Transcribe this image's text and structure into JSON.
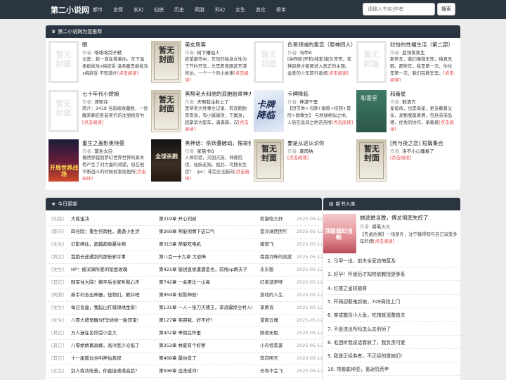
{
  "site": {
    "logo": "第二小说网"
  },
  "nav": [
    "都市",
    "言情",
    "玄幻",
    "仙侠",
    "历史",
    "网游",
    "科幻",
    "女生",
    "其它",
    "榜单"
  ],
  "search": {
    "placeholder": "请输入书名|作者",
    "button": "搜索"
  },
  "recommend": {
    "title": "第二小说网为您推荐",
    "author_label": "作者:",
    "more_label": "[点击阅读]",
    "items": [
      {
        "cover": "placeholder",
        "cover_text": "暂无封面",
        "title": "眼",
        "author": "咯咯咯鸽子精",
        "desc": "文案：我一直在看着你。年下温柔疯批攻x纯欲受 温柔腹黑疯批攻x纯欲受 不知道什"
      },
      {
        "cover": "classic",
        "cover_text": "暂无封面",
        "title": "美女房客",
        "author": "树下睡仙人",
        "desc": "欲望都市中，年轻的独身女性为了节约开支，总是愿意跟这开游所达。一个一个的小故事"
      },
      {
        "cover": "placeholder",
        "cover_text": "暂无封面",
        "title": "负哥领域的爱恋（原神同人）",
        "author": "马甲A",
        "desc": "[钟西粉|罗莉|纯爱]我负哥哥，花神诞祭才刚要进入真正的主题。金爱的少年旅行者却"
      },
      {
        "cover": "placeholder",
        "cover_text": "暂无封面",
        "title": "欣怡的性福生活（第二部）",
        "author": "蓝领笑笑生",
        "desc": "那些年，我们憧憬无知，纯真无暇。那些年，我是第一次，你也是第一次，我们在教室里。"
      },
      {
        "cover": "placeholder",
        "cover_text": "暂无封面",
        "title": "七十年代小娇娘",
        "author": "清知许",
        "desc": "简介：2418 当前被收藏数，一觉醒来躺在卧装美仍的沈丽桃穿书"
      },
      {
        "cover": "classic",
        "cover_text": "暂无封面",
        "title": "黑帮老大和他的双胞胎哥神大哥",
        "author": "天啊我注射上了",
        "desc": "黑帮老大性事全记录，有双胞胎哥哥攻，有小舅舅攻，下属攻，超豪华大配车，满满满，汉"
      },
      {
        "cover": "anime",
        "cover_text": "卡牌降临",
        "title": "卡牌降临",
        "author": "神游千里",
        "desc": "【恒节类+卡牌+御兽+校园+冒险+群像文】 与地球相似之地，人族在此间之地苦苦挣"
      },
      {
        "cover": "jade",
        "cover_text": "和番星",
        "title": "和番星",
        "author": "鹤清方",
        "desc": "星母命，也是母星，更亲戴着父亲，发甄我莫黄情，包括弟弟品德，优秀的协作，承载着"
      },
      {
        "cover": "war",
        "cover_text": "开局世界战场",
        "title": "重生之盖影奥特曼",
        "author": "莫生太白",
        "desc": "偶然穿越到梦幻世界世界的真木传产生了对力量的渴望，但在他不断战斗的时候却发现他所"
      },
      {
        "cover": "dark",
        "cover_text": "全球杀戮",
        "title": "黑神话：杀妖叠破动，猴哥我又又义",
        "author": "家猫书Q",
        "desc": "人体实验，灭国灭族，神佛院伐，仙妖走狗。如此…可拥长生否？（ps：非完全玉脑向"
      },
      {
        "cover": "classic",
        "cover_text": "暂无封面",
        "title": "要是从这认识你",
        "author": "夏雨纳",
        "desc": ""
      },
      {
        "cover": "classic",
        "cover_text": "暂无封面",
        "title": "[死与夜之恋] 短篇集合",
        "author": "洛不小心睡着了",
        "desc": ""
      }
    ]
  },
  "today": {
    "title": "今日更新",
    "rows": [
      {
        "cat": "[仙侠]",
        "title": "大炼宝决",
        "chapter": "第219章 开心刘叔",
        "author": "熊猫吃大虾",
        "date": "2025-05-12"
      },
      {
        "cat": "[都市]",
        "title": "四合院：重生何雨柱，遭遇小生活",
        "chapter": "第269章 帮能彻情下这口气",
        "author": "是冷渊团团吖",
        "date": "2025-05-12"
      },
      {
        "cat": "[女生]",
        "title": "幻影绑仙，超越超级暴生物",
        "chapter": "第315章 帮能吃电机",
        "author": "猪僧飞",
        "date": "2025-05-12"
      },
      {
        "cat": "[其它]",
        "title": "我跑长途遇到的那些邪乎事",
        "chapter": "第八百一十九章 大恐怖",
        "author": "南路河畔的纯爱",
        "date": "2025-05-12"
      },
      {
        "cat": "[女生]",
        "title": "HP：被深渊所爱的铂金玫瑰",
        "chapter": "第421章 铍锐直觉遭遇是也，前线cp刷夫子",
        "author": "乐乐憨",
        "date": "2025-05-12"
      },
      {
        "cat": "[其它]",
        "title": "随军住大院！躺平后全家听我心声",
        "chapter": "第742章 一会更比一山高",
        "author": "红姜菠萝啤",
        "date": "2025-05-12"
      },
      {
        "cat": "[网游]",
        "title": "新手村合出神器，怪物们，颤抖吧",
        "chapter": "第959章 软影神很!",
        "author": "游戏的人生",
        "date": "2025-05-12"
      },
      {
        "cat": "[女生]",
        "title": "每日盲盒，我起山打猎锦绣金家!",
        "chapter": "第131章 一人一张刀灭猪王，李浪震惊全村人!",
        "author": "李黄良",
        "date": "2025-05-12"
      },
      {
        "cat": "[女生]",
        "title": "八零大佬觉醒!好孕娇娇一胎双宝!",
        "chapter": "第127章 笑容我，好不好?",
        "author": "望南云槿",
        "date": "2025-05-12"
      },
      {
        "cat": "[其它]",
        "title": "万人迷在名何受小变大",
        "chapter": "第402章 举倒在怀里",
        "author": "眼夜无眠",
        "date": "2025-05-12"
      },
      {
        "cat": "[其它]",
        "title": "八零娇娇再高嫁，高冷医少沦陷了",
        "chapter": "第252章 林夏有个好爹",
        "author": "小舟惊素菱",
        "date": "2025-05-12"
      },
      {
        "cat": "[其它]",
        "title": "十一尾狐仙也叫神仙叔叔",
        "chapter": "第468章 最你变了",
        "author": "奔向明天",
        "date": "2025-05-12"
      },
      {
        "cat": "[女生]",
        "title": "别人练功吃苦，你直接递递高武?",
        "chapter": "第596章 血洗成河!",
        "author": "长寿不会飞",
        "date": "2025-05-12"
      }
    ]
  },
  "new_books": {
    "title": "新书入库",
    "featured": {
      "cover_text": "顶级媳妇当晚",
      "title": "她逃婚当晚，傅总彻底失控了",
      "author": "扁笔火火",
      "desc": "【先虐后爽】一场意外，沈宁薇得知与自己深爱多年的傅",
      "more": "[点击阅读]"
    },
    "author_label": "作者:",
    "items": [
      "2. 马甲一出，前夫全家追悔莫及",
      "3. 好孕！怀崽后才知禁欲教授是爹系",
      "4. 红楼之皇权植脊",
      "5. 开局迎娶鬼新娘，749局找上门",
      "6. 穿成搬货小人鱼，吃饱就混整兽夫",
      "7. 不是流出所吗怎么去刑侦了",
      "8. 毛团听我说话春疯了，我负责可爱",
      "9. 我是正经务者，不正经的是她们!",
      "10. 带着乾坤壶，重返饥荒年"
    ]
  }
}
